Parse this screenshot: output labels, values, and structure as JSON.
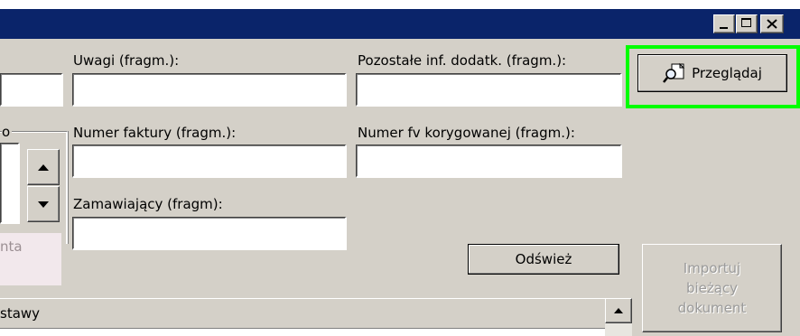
{
  "window": {
    "caption_buttons": [
      {
        "name": "minimize",
        "icon": "minimize-icon"
      },
      {
        "name": "maximize",
        "icon": "maximize-icon"
      },
      {
        "name": "close",
        "icon": "close-icon"
      }
    ]
  },
  "filters": {
    "uwagi_label": "Uwagi (fragm.):",
    "uwagi_value": "",
    "pozostale_label": "Pozostałe inf. dodatk. (fragm.):",
    "pozostale_value": "",
    "numer_faktury_label": "Numer faktury (fragm.):",
    "numer_faktury_value": "",
    "numer_fv_kor_label": "Numer fv korygowanej (fragm.):",
    "numer_fv_kor_value": "",
    "zamawiajacy_label": "Zamawiający (fragm):",
    "zamawiajacy_value": ""
  },
  "left_panel": {
    "group_label_fragment": "o",
    "partial_text": "nta"
  },
  "buttons": {
    "przegladaj": "Przeglądaj",
    "odswiez": "Odśwież",
    "importuj_line1": "Importuj",
    "importuj_line2": "bieżący",
    "importuj_line3": "dokument"
  },
  "list": {
    "column_header_fragment": "stawy"
  },
  "colors": {
    "titlebar": "#0a246a",
    "highlight": "#00ff00",
    "face": "#d4d0c8"
  }
}
